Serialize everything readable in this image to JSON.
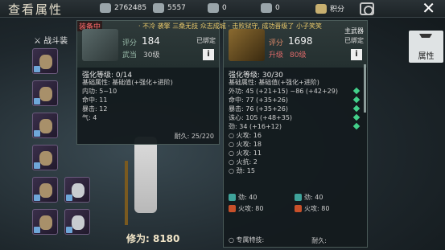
{
  "header": {
    "title": "查看属性",
    "cur1": "2762485",
    "cur2": "5557",
    "cur3": "0",
    "cur4": "0",
    "jifen": "积分",
    "close": "✕"
  },
  "left": {
    "tab_label": "战斗装",
    "score": "修为: 8180"
  },
  "notice": "· 不冷 袭擎 三桑无技 众志成城 · 击败狱守, 成功晋级了 小子笑笑",
  "p1": {
    "tag": "装备中",
    "score_label": "评分",
    "score": "184",
    "lv_label": "武当",
    "lv": "30级",
    "bound": "已绑定",
    "info": "i",
    "lines": [
      {
        "t": "强化等级: 0/14",
        "cls": "h"
      },
      {
        "t": "基础属性: 基础值(+强化+进阶)",
        "cls": ""
      },
      {
        "t": "内功: 5~10",
        "cls": ""
      },
      {
        "t": "命中: 11",
        "cls": ""
      },
      {
        "t": "暴击: 12",
        "cls": ""
      },
      {
        "t": "气: 4",
        "cls": ""
      }
    ],
    "durability": "耐久: 25/220"
  },
  "p2": {
    "weapon": "主武器",
    "score_label": "评分",
    "score": "1698",
    "lv_label": "升级",
    "lv": "80级",
    "bound": "已绑定",
    "info": "i",
    "lines": [
      {
        "t": "强化等级: 30/30",
        "cls": "h"
      },
      {
        "t": "基础属性: 基础值(+强化+进阶)",
        "cls": ""
      },
      {
        "t": "外功: 45 (+21+15) ~86 (+42+29)",
        "cls": ""
      },
      {
        "t": "命中: 77 (+35+26)",
        "cls": ""
      },
      {
        "t": "暴击: 76 (+35+26)",
        "cls": ""
      },
      {
        "t": "诛心: 105 (+48+35)",
        "cls": ""
      },
      {
        "t": "劲: 34 (+16+12)",
        "cls": ""
      },
      {
        "t": "○ 火攻: 16",
        "cls": ""
      },
      {
        "t": "○ 火攻: 18",
        "cls": ""
      },
      {
        "t": "○ 火攻: 11",
        "cls": ""
      },
      {
        "t": "○ 火抗: 2",
        "cls": ""
      },
      {
        "t": "○ 劲: 15",
        "cls": ""
      }
    ],
    "gems": [
      {
        "a": "劲: 40",
        "b": "劲: 40"
      },
      {
        "a": "火攻: 80",
        "b": "火攻: 80"
      }
    ],
    "special": "○ 专属特技:",
    "durability": "耐久:"
  },
  "rtab": {
    "label": "属性"
  }
}
